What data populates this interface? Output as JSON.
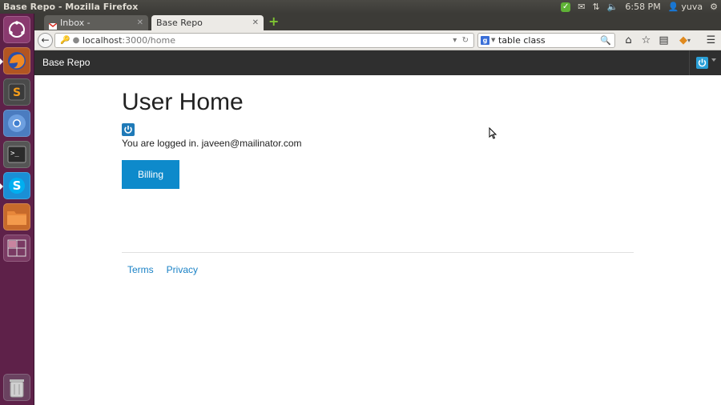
{
  "system": {
    "window_title": "Base Repo - Mozilla Firefox",
    "clock": "6:58 PM",
    "user": "yuva"
  },
  "browser": {
    "tabs": [
      {
        "label": "Inbox - prateekyuva...",
        "active": false
      },
      {
        "label": "Base Repo",
        "active": true
      }
    ],
    "url": {
      "host": "localhost",
      "path": ":3000/home"
    },
    "search": {
      "engine": "google",
      "value": "table class"
    }
  },
  "app": {
    "brand": "Base Repo"
  },
  "main": {
    "title": "User Home",
    "login_message": "You are logged in. javeen@mailinator.com",
    "billing_button": "Billing"
  },
  "footer": {
    "links": [
      "Terms",
      "Privacy"
    ]
  },
  "colors": {
    "launcher": "#5e2149",
    "app_header": "#2f2f2f",
    "accent": "#0e8acb",
    "link": "#1a82c6"
  }
}
